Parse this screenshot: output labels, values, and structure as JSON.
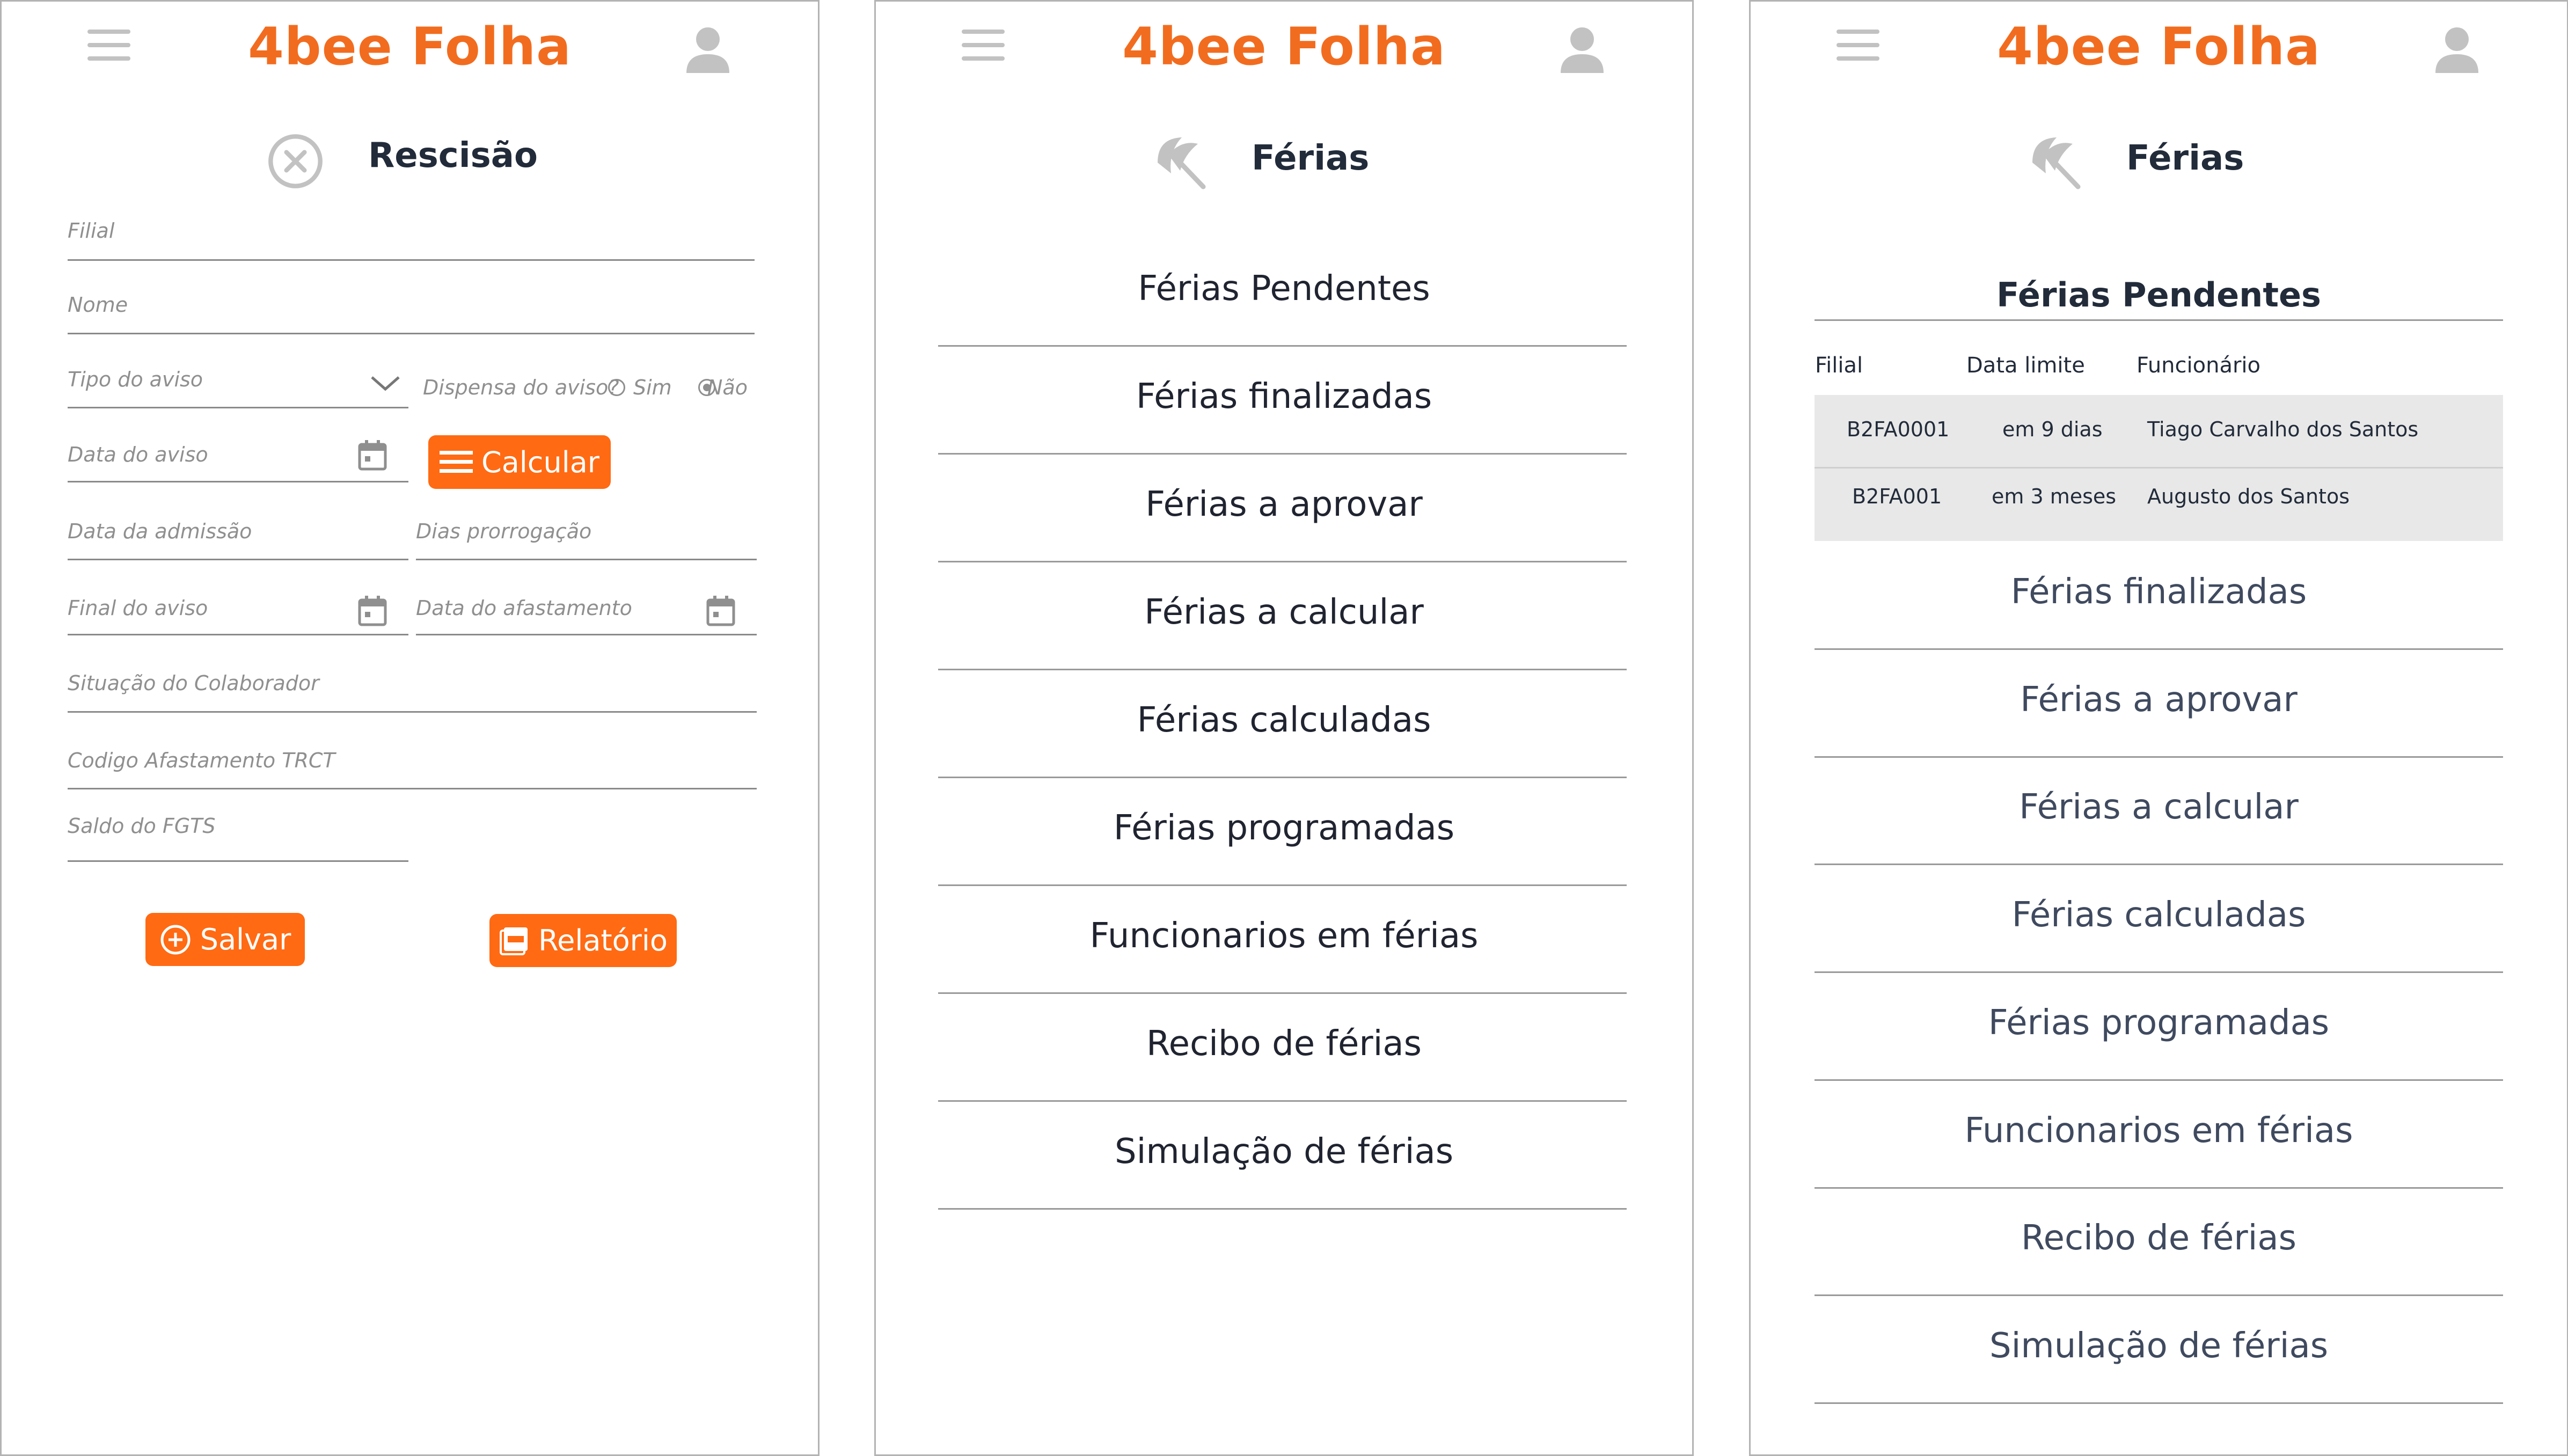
{
  "app": {
    "title": "4bee Folha"
  },
  "colors": {
    "accent": "#f26c1f",
    "button": "#ff6a13",
    "text_dark": "#222b3a",
    "text_menu2": "#202430",
    "text_menu3": "#3f4a5f",
    "label_gray": "#8f8f8f"
  },
  "screen1": {
    "heading": "Rescisão",
    "heading_icon": "cancel-circle-icon",
    "fields": {
      "filial": "Filial",
      "nome": "Nome",
      "tipo_aviso": "Tipo do aviso",
      "dispensa": "Dispensa do aviso?",
      "sim": "Sim",
      "nao": "Não",
      "data_aviso": "Data do aviso",
      "data_admissao": "Data da admissão",
      "dias_prorrogacao": "Dias prorrogação",
      "final_aviso": "Final do aviso",
      "data_afastamento": "Data do afastamento",
      "situacao": "Situação do Colaborador",
      "codigo": "Codigo Afastamento TRCT",
      "saldo": "Saldo do FGTS"
    },
    "buttons": {
      "calcular": "Calcular",
      "salvar": "Salvar",
      "relatorio": "Relatório"
    }
  },
  "screen2": {
    "heading": "Férias",
    "heading_icon": "beach-umbrella-icon",
    "menu": [
      "Férias Pendentes",
      "Férias finalizadas",
      "Férias a aprovar",
      "Férias a calcular",
      "Férias calculadas",
      "Férias programadas",
      "Funcionarios em férias",
      "Recibo de férias",
      "Simulação de férias"
    ]
  },
  "screen3": {
    "heading": "Férias",
    "heading_icon": "beach-umbrella-icon",
    "section_title": "Férias Pendentes",
    "table": {
      "headers": [
        "Filial",
        "Data limite",
        "Funcionário"
      ],
      "rows": [
        [
          "B2FA0001",
          "em 9 dias",
          "Tiago Carvalho dos Santos"
        ],
        [
          "B2FA001",
          "em 3 meses",
          "Augusto dos Santos"
        ]
      ]
    },
    "menu": [
      "Férias finalizadas",
      "Férias a aprovar",
      "Férias a calcular",
      "Férias calculadas",
      "Férias programadas",
      "Funcionarios em férias",
      "Recibo de férias",
      "Simulação de férias"
    ]
  }
}
